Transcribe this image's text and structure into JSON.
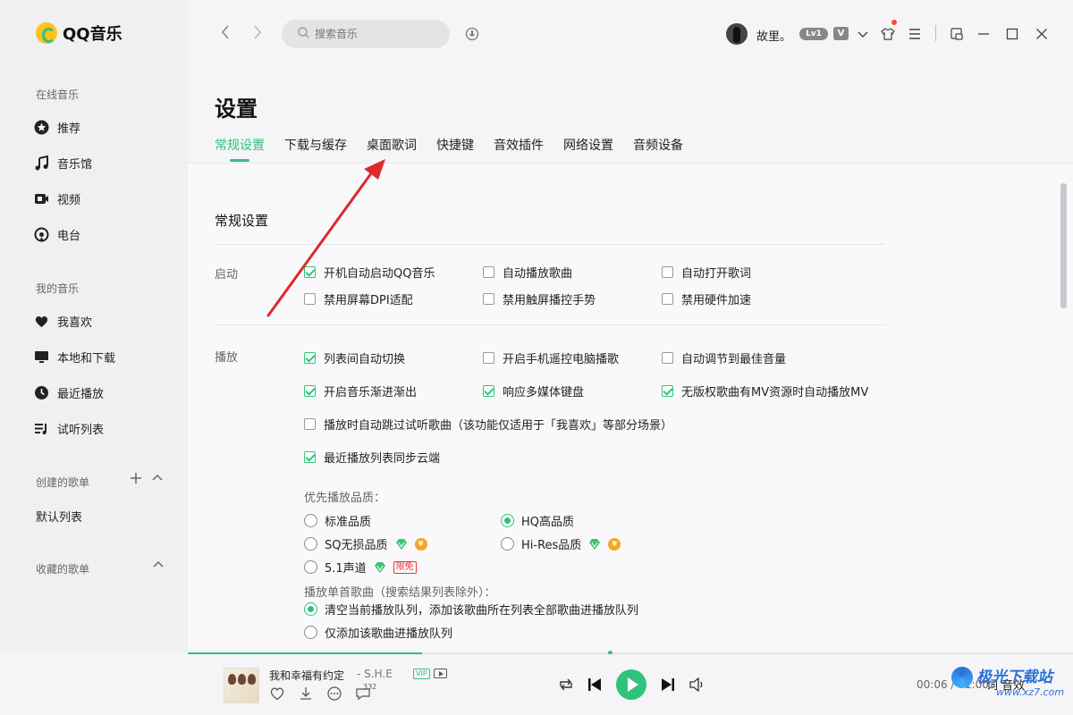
{
  "app": {
    "logo_text": "QQ音乐"
  },
  "sidebar": {
    "online_title": "在线音乐",
    "online_items": [
      {
        "label": "推荐",
        "icon": "star-icon"
      },
      {
        "label": "音乐馆",
        "icon": "music-note-icon"
      },
      {
        "label": "视频",
        "icon": "video-icon"
      },
      {
        "label": "电台",
        "icon": "radio-icon"
      }
    ],
    "my_title": "我的音乐",
    "my_items": [
      {
        "label": "我喜欢",
        "icon": "heart-icon"
      },
      {
        "label": "本地和下载",
        "icon": "monitor-icon"
      },
      {
        "label": "最近播放",
        "icon": "clock-icon"
      },
      {
        "label": "试听列表",
        "icon": "playlist-icon"
      }
    ],
    "created_title": "创建的歌单",
    "default_list": "默认列表",
    "collected_title": "收藏的歌单"
  },
  "topbar": {
    "search_placeholder": "搜索音乐",
    "username": "故里。",
    "level_badge": "Lv1",
    "vip_badge": "V"
  },
  "settings": {
    "title": "设置",
    "tabs": [
      "常规设置",
      "下载与缓存",
      "桌面歌词",
      "快捷键",
      "音效插件",
      "网络设置",
      "音频设备"
    ],
    "active_tab": "常规设置",
    "section_title": "常规设置",
    "startup": {
      "label": "启动",
      "options": [
        {
          "label": "开机自动启动QQ音乐",
          "checked": true
        },
        {
          "label": "自动播放歌曲",
          "checked": false
        },
        {
          "label": "自动打开歌词",
          "checked": false
        },
        {
          "label": "禁用屏幕DPI适配",
          "checked": false
        },
        {
          "label": "禁用触屏播控手势",
          "checked": false
        },
        {
          "label": "禁用硬件加速",
          "checked": false
        }
      ]
    },
    "playback": {
      "label": "播放",
      "options": [
        {
          "label": "列表间自动切换",
          "checked": true
        },
        {
          "label": "开启手机遥控电脑播歌",
          "checked": false
        },
        {
          "label": "自动调节到最佳音量",
          "checked": false
        },
        {
          "label": "开启音乐渐进渐出",
          "checked": true
        },
        {
          "label": "响应多媒体键盘",
          "checked": true
        },
        {
          "label": "无版权歌曲有MV资源时自动播放MV",
          "checked": true
        },
        {
          "label": "播放时自动跳过试听歌曲（该功能仅适用于「我喜欢」等部分场景）",
          "checked": false
        },
        {
          "label": "最近播放列表同步云端",
          "checked": true
        }
      ],
      "quality_label": "优先播放品质：",
      "quality_options": [
        {
          "label": "标准品质",
          "selected": false
        },
        {
          "label": "HQ高品质",
          "selected": true
        },
        {
          "label": "SQ无损品质",
          "selected": false
        },
        {
          "label": "Hi-Res品质",
          "selected": false
        },
        {
          "label": "5.1声道",
          "selected": false
        }
      ],
      "limit_tag": "限免",
      "single_label": "播放单首歌曲（搜索结果列表除外）：",
      "single_options": [
        {
          "label": "清空当前播放队列，添加该歌曲所在列表全部歌曲进播放队列",
          "selected": true
        },
        {
          "label": "仅添加该歌曲进播放队列",
          "selected": false
        }
      ]
    }
  },
  "player": {
    "song_title": "我和幸福有约定",
    "artist": "- S.H.E",
    "vip_tag": "VIP",
    "comment_count": "332",
    "time": "00:06 / 01:00",
    "extra_labels": "词  音效",
    "progress": 0.265,
    "accent_color": "#31c27c"
  },
  "watermark": {
    "text": "极光下载站",
    "sub": "www.xz7.com"
  }
}
